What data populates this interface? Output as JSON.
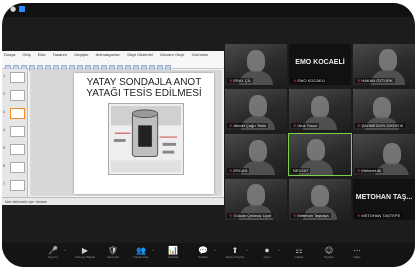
{
  "top_bar": {
    "status": "●"
  },
  "share": {
    "ribbon_tabs": [
      "Dosya",
      "Giriş",
      "Ekle",
      "Tasarım",
      "Geçişler",
      "Animasyonlar",
      "Slayt Gösterisi",
      "Gözden Geçir",
      "Görünüm"
    ],
    "slide_title_line1": "YATAY SONDAJLA ANOT",
    "slide_title_line2": "YATAĞI TESİS EDİLMESİ",
    "thumb_numbers": [
      "1",
      "2",
      "3",
      "4",
      "5",
      "6",
      "7"
    ],
    "notes_placeholder": "Not eklemek için tıklatın"
  },
  "participants": [
    {
      "name": "ERAL ÇİL",
      "video": true
    },
    {
      "name": "EMO KOCAELİ",
      "video": false,
      "big_label": "EMO KOCAELİ"
    },
    {
      "name": "HAKAN ÖZTÜRK",
      "video": true
    },
    {
      "name": "Ahmet Çağrı Tekin",
      "video": true
    },
    {
      "name": "Ufuk Tosun",
      "video": true
    },
    {
      "name": "ŞAHMEDDİN DİKBIYIK",
      "video": true
    },
    {
      "name": "ERCAN",
      "video": true
    },
    {
      "name": "NEVZAT",
      "video": true,
      "active": true
    },
    {
      "name": "Mehmet Ali",
      "video": true
    },
    {
      "name": "Gülcan Çekinaz Uçar",
      "video": true
    },
    {
      "name": "Metehan Taşkaya",
      "video": true
    },
    {
      "name": "METOHAN TAŞTEPE",
      "video": false,
      "big_label": "METOHAN TAŞ..."
    }
  ],
  "toolbar": {
    "buttons": [
      {
        "icon": "🎤",
        "label": "Sesi Aç"
      },
      {
        "icon": "▶",
        "label": "Videoyu Başlat"
      },
      {
        "icon": "🛡",
        "label": "Güvenlik"
      },
      {
        "icon": "👥",
        "label": "Katılımcılar"
      },
      {
        "icon": "📊",
        "label": "Anketler"
      },
      {
        "icon": "💬",
        "label": "Sohbet"
      },
      {
        "icon": "⬆",
        "label": "Ekranı Paylaş"
      },
      {
        "icon": "⏺",
        "label": "Kayıt"
      },
      {
        "icon": "⚏",
        "label": "Odalar"
      },
      {
        "icon": "☺",
        "label": "Tepkiler"
      },
      {
        "icon": "⋯",
        "label": "Diğer"
      }
    ]
  }
}
